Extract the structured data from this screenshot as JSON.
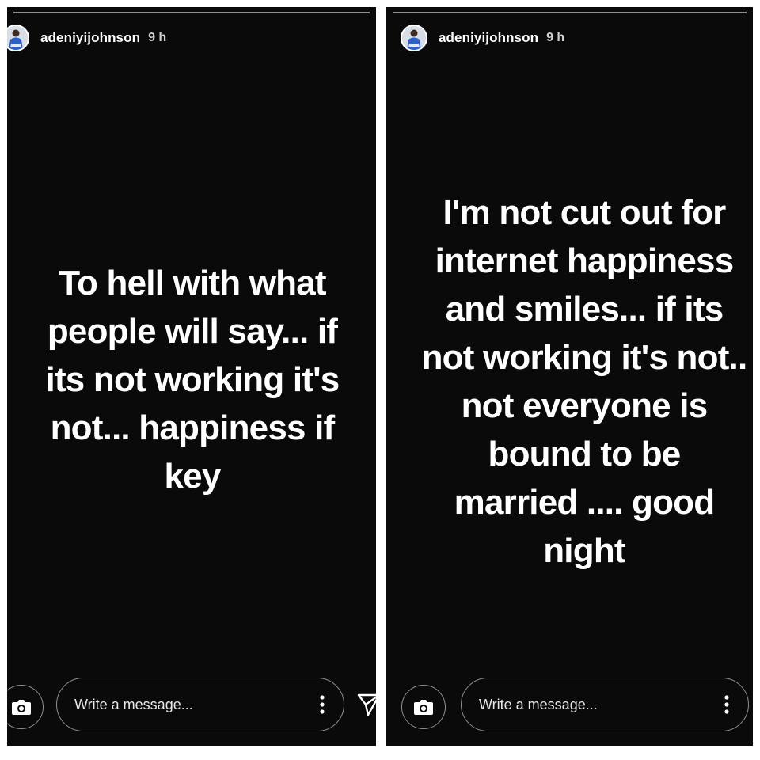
{
  "stories": [
    {
      "username": "adeniyijohnson",
      "time": "9 h",
      "text": "To hell with what\npeople will say...  if\nits not working it's\nnot... happiness if\nkey",
      "message_placeholder": "Write a message...",
      "icons": {
        "avatar": "profile-avatar",
        "camera": "camera-icon",
        "menu": "more-options-icon",
        "send": "send-icon"
      }
    },
    {
      "username": "adeniyijohnson",
      "time": "9 h",
      "text": "I'm not cut out for\ninternet happiness\nand smiles... if its\nnot working it's not..\nnot everyone is\nbound to be\nmarried .... good\nnight",
      "message_placeholder": "Write a message...",
      "icons": {
        "avatar": "profile-avatar",
        "camera": "camera-icon",
        "menu": "more-options-icon"
      }
    }
  ],
  "colors": {
    "story_background": "#0a0a0a",
    "text": "#ffffff",
    "frame": "#ffffff"
  }
}
